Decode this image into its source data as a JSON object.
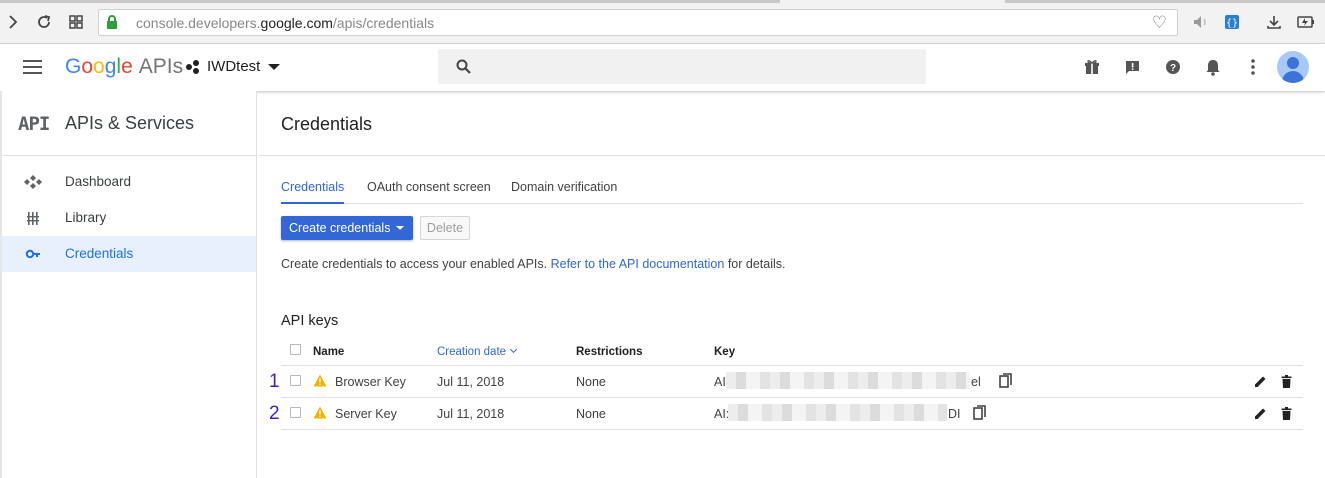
{
  "browser": {
    "url_prefix": "console.developers.",
    "url_host": "google.com",
    "url_path": "/apis/credentials"
  },
  "header": {
    "logo_letters": [
      "G",
      "o",
      "o",
      "g",
      "l",
      "e"
    ],
    "logo_suffix": "APIs",
    "project_name": "IWDtest",
    "search_placeholder": ""
  },
  "sidebar": {
    "mark": "API",
    "title": "APIs & Services",
    "items": [
      {
        "label": "Dashboard",
        "icon": "dashboard-icon",
        "active": false
      },
      {
        "label": "Library",
        "icon": "library-icon",
        "active": false
      },
      {
        "label": "Credentials",
        "icon": "key-icon",
        "active": true
      }
    ]
  },
  "main": {
    "title": "Credentials",
    "tabs": [
      {
        "label": "Credentials",
        "active": true
      },
      {
        "label": "OAuth consent screen",
        "active": false
      },
      {
        "label": "Domain verification",
        "active": false
      }
    ],
    "create_button": "Create credentials",
    "delete_button": "Delete",
    "info_prefix": "Create credentials to access your enabled APIs.",
    "info_link": "Refer to the API documentation",
    "info_suffix": "for details.",
    "section_title": "API keys",
    "columns": {
      "name": "Name",
      "creation_date": "Creation date",
      "restrictions": "Restrictions",
      "key": "Key"
    },
    "rows": [
      {
        "number": "1",
        "name": "Browser Key",
        "date": "Jul 11, 2018",
        "restrictions": "None",
        "key_start": "AI",
        "key_end": "el"
      },
      {
        "number": "2",
        "name": "Server Key",
        "date": "Jul 11, 2018",
        "restrictions": "None",
        "key_start": "AI:",
        "key_end": "DI"
      }
    ]
  },
  "colors": {
    "accent": "#3367d6",
    "warning": "#f4b400",
    "active_nav_bg": "#e8f0fe",
    "annotation": "#3a1fd9"
  }
}
